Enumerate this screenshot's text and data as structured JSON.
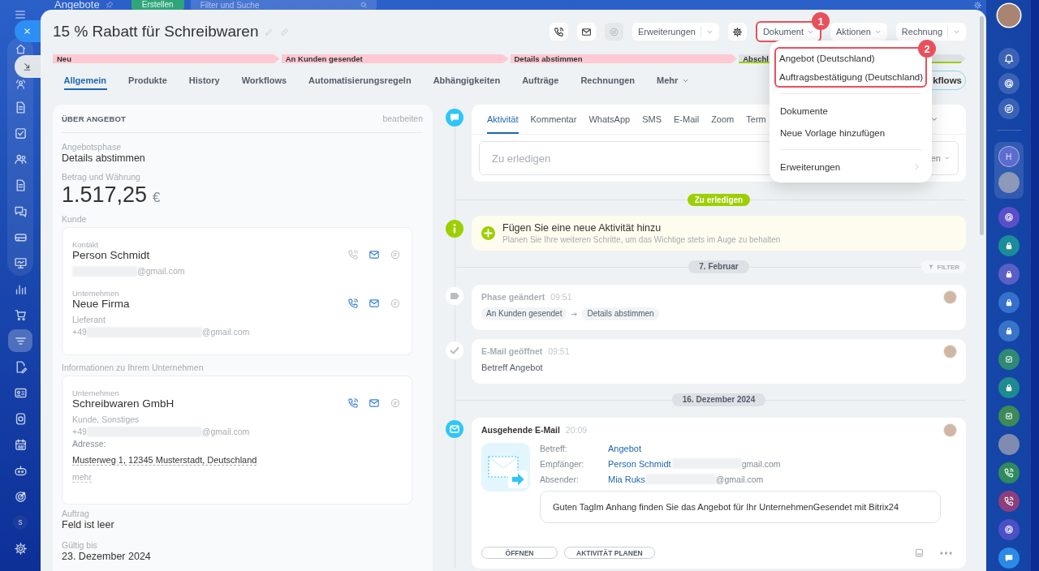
{
  "page_header": {
    "title": "Angebote",
    "create_button": "Erstellen",
    "search": {
      "placeholder": "Filter und Suche"
    }
  },
  "left_nav": {
    "items": [
      {
        "kind": "icon",
        "selected": false
      },
      {
        "kind": "icon",
        "selected": false
      },
      {
        "kind": "icon",
        "selected": false
      },
      {
        "kind": "icon",
        "selected": false
      },
      {
        "kind": "icon",
        "selected": false
      },
      {
        "kind": "icon",
        "selected": false
      },
      {
        "kind": "icon",
        "selected": false
      },
      {
        "kind": "icon",
        "selected": false
      },
      {
        "kind": "icon",
        "selected": false
      },
      {
        "kind": "icon",
        "selected": false
      },
      {
        "kind": "icon",
        "selected": false
      },
      {
        "kind": "icon",
        "selected": true
      },
      {
        "kind": "icon",
        "selected": false
      },
      {
        "kind": "icon",
        "selected": false
      },
      {
        "kind": "icon",
        "selected": false
      },
      {
        "kind": "icon",
        "selected": false
      },
      {
        "kind": "icon",
        "selected": false
      },
      {
        "kind": "icon",
        "selected": false
      },
      {
        "kind": "letter",
        "label": "s",
        "selected": false
      },
      {
        "kind": "icon",
        "selected": false
      }
    ]
  },
  "right_bar": {
    "group": {
      "initial": "H"
    },
    "chats": [
      {
        "kind": "icon",
        "color": "#5b4fc9"
      },
      {
        "kind": "icon",
        "color": "#1b8c99"
      },
      {
        "kind": "icon",
        "color": "#5a5fc6"
      },
      {
        "kind": "icon",
        "color": "#3470cc"
      },
      {
        "kind": "icon",
        "color": "#3a74c9"
      },
      {
        "kind": "icon",
        "color": "#2f8a74"
      },
      {
        "kind": "icon",
        "color": "#1f8a90"
      },
      {
        "kind": "icon",
        "color": "#3c8a58"
      },
      {
        "kind": "photo"
      },
      {
        "kind": "icon",
        "color": "#2f8a5c"
      },
      {
        "kind": "icon",
        "color": "#8c3f7c"
      },
      {
        "kind": "icon",
        "color": "#4d4fc6"
      },
      {
        "kind": "icon",
        "color": "#2b8ae6"
      }
    ]
  },
  "deal": {
    "title": "15 % Rabatt für Schreibwaren"
  },
  "toolbar": [
    {
      "kind": "icon",
      "disabled": false
    },
    {
      "kind": "icon",
      "disabled": false
    },
    {
      "kind": "icon",
      "disabled": true
    },
    {
      "kind": "split",
      "label": "Erweiterungen"
    },
    {
      "kind": "icon",
      "disabled": false
    },
    {
      "kind": "dropdown",
      "label": "Dokument",
      "callout": "1"
    },
    {
      "kind": "dropdown",
      "label": "Aktionen"
    },
    {
      "kind": "split",
      "label": "Rechnung"
    }
  ],
  "stages": [
    {
      "label": "Neu",
      "reached": true,
      "kind": "process"
    },
    {
      "label": "An Kunden gesendet",
      "reached": true,
      "kind": "process"
    },
    {
      "label": "Details abstimmen",
      "reached": true,
      "kind": "process"
    },
    {
      "label": "Abschl",
      "reached": false,
      "kind": "success"
    }
  ],
  "tabs": [
    {
      "label": "Allgemein",
      "selected": true,
      "kind": "tab"
    },
    {
      "label": "Produkte",
      "selected": false,
      "kind": "tab"
    },
    {
      "label": "History",
      "selected": false,
      "kind": "tab"
    },
    {
      "label": "Workflows",
      "selected": false,
      "kind": "tab"
    },
    {
      "label": "Automatisierungsregeln",
      "selected": false,
      "kind": "tab"
    },
    {
      "label": "Abhängigkeiten",
      "selected": false,
      "kind": "tab"
    },
    {
      "label": "Aufträge",
      "selected": false,
      "kind": "tab"
    },
    {
      "label": "Rechnungen",
      "selected": false,
      "kind": "tab"
    },
    {
      "label": "Mehr",
      "selected": false,
      "kind": "more"
    }
  ],
  "side_button": {
    "label": "kflows"
  },
  "about": {
    "heading": "ÜBER ANGEBOT",
    "edit_link": "bearbeiten",
    "phase": {
      "label": "Angebotsphase",
      "value": "Details abstimmen"
    },
    "amount": {
      "label": "Betrag und Währung",
      "value": "1.517,25",
      "currency": "€"
    },
    "client": {
      "label": "Kunde",
      "entries": [
        {
          "type_label": "Kontakt",
          "name": "Person Schmidt",
          "call_available": false,
          "lines": [
            {
              "kind": "contact",
              "suffix": "@gmail.com"
            }
          ]
        },
        {
          "type_label": "Unternehmen",
          "name": "Neue Firma",
          "call_available": true,
          "lines": [
            {
              "kind": "plain",
              "text": "Lieferant"
            },
            {
              "kind": "contact",
              "prefix": "+49",
              "suffix": "@gmail.com"
            }
          ]
        }
      ]
    },
    "company": {
      "label": "Informationen zu Ihrem Unternehmen",
      "entries": [
        {
          "type_label": "Unternehmen",
          "name": "Schreibwaren GmbH",
          "call_available": true,
          "lines": [
            {
              "kind": "plain",
              "text": "Kunde, Sonstiges"
            },
            {
              "kind": "contact",
              "prefix": "+49",
              "suffix": "@gmail.com"
            },
            {
              "kind": "label",
              "text": "Adresse:"
            },
            {
              "kind": "address",
              "text": "Musterweg 1, 12345 Musterstadt, Deutschland"
            },
            {
              "kind": "more",
              "text": "mehr"
            }
          ]
        }
      ]
    },
    "fields": [
      {
        "label": "Auftrag",
        "value": "Feld ist leer"
      },
      {
        "label": "Gültig bis",
        "value": "23. Dezember 2024"
      }
    ]
  },
  "timeline": {
    "composer": {
      "tabs": [
        {
          "label": "Aktivität",
          "selected": true
        },
        {
          "label": "Kommentar",
          "selected": false
        },
        {
          "label": "WhatsApp",
          "selected": false
        },
        {
          "label": "SMS",
          "selected": false
        },
        {
          "label": "E-Mail",
          "selected": false
        },
        {
          "label": "Zoom",
          "selected": false
        },
        {
          "label": "Term",
          "selected": false
        }
      ],
      "input": {
        "placeholder": "Zu erledigen"
      },
      "side_control": "en"
    },
    "todo_badge": "Zu erledigen",
    "hint": {
      "title": "Fügen Sie eine neue Aktivität hinzu",
      "text": "Planen Sie Ihre weiteren Schritte, um das Wichtige stets im Auge zu behalten"
    },
    "groups": [
      {
        "date": "7. Februar",
        "filter": "FILTER",
        "items": [
          {
            "kind": "stage_change",
            "title": "Phase geändert",
            "time": "09:51",
            "from": "An Kunden gesendet",
            "to": "Details abstimmen"
          },
          {
            "kind": "email_opened",
            "title": "E-Mail geöffnet",
            "time": "09:51",
            "text": "Betreff Angebot"
          }
        ]
      },
      {
        "date": "16. Dezember 2024",
        "items": [
          {
            "kind": "email_out",
            "title": "Ausgehende E-Mail",
            "time": "20:09",
            "fields": [
              {
                "label": "Betreff:",
                "value": "Angebot"
              },
              {
                "label": "Empfänger:",
                "value": "Person Schmidt",
                "suffix": "gmail.com"
              },
              {
                "label": "Absender:",
                "value": "Mia Ruks",
                "suffix": "@gmail.com"
              }
            ],
            "body": "Guten TagIm Anhang finden Sie das Angebot für Ihr UnternehmenGesendet mit Bitrix24",
            "buttons": [
              "ÖFFNEN",
              "AKTIVITÄT PLANEN"
            ]
          }
        ]
      }
    ]
  },
  "document_menu": {
    "sections": [
      {
        "callout": "2",
        "items": [
          {
            "label": "Angebot (Deutschland)",
            "submenu": false
          },
          {
            "label": "Auftragsbestätigung (Deutschland)",
            "submenu": false
          }
        ]
      },
      {
        "items": [
          {
            "label": "Dokumente",
            "submenu": false
          },
          {
            "label": "Neue Vorlage hinzufügen",
            "submenu": false
          }
        ]
      },
      {
        "items": [
          {
            "label": "Erweiterungen",
            "submenu": true
          }
        ]
      }
    ]
  }
}
